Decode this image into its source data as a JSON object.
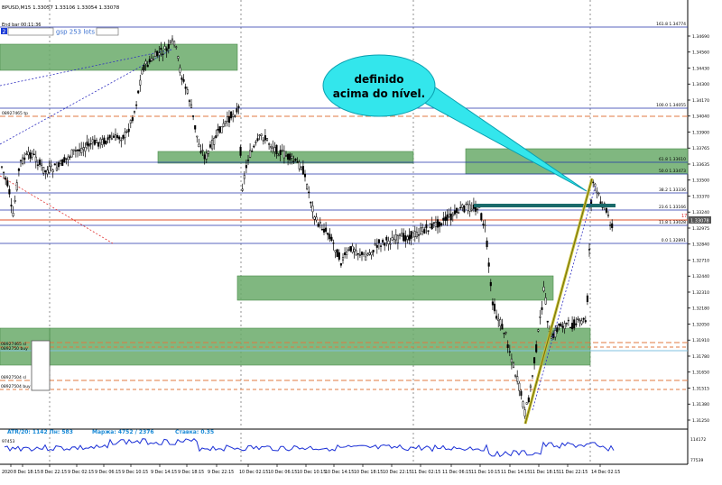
{
  "header": {
    "symbol_line": "BPUSD,M15  1.33057 1.33106 1.33054 1.33078",
    "end_bar": "End bar 00:11:36",
    "lot_badge": "2",
    "lot_text": "gsp 253 lots"
  },
  "annotation": {
    "line1": "definido",
    "line2": "acima do nível."
  },
  "colors": {
    "zone_fill": "#6aaa6a",
    "callout_fill": "#33e6ec",
    "price_line": "#e0502a",
    "fib_line": "#2233aa",
    "trend_line": "#c8c030",
    "candle": "#000000",
    "indicator_line": "#1a2fd6"
  },
  "price_axis": {
    "ticks": [
      "1.34690",
      "1.34560",
      "1.34430",
      "1.34300",
      "1.34170",
      "1.34040",
      "1.33900",
      "1.33765",
      "1.33635",
      "1.33500",
      "1.33370",
      "1.33240",
      "1.32975",
      "1.32840",
      "1.32710",
      "1.32440",
      "1.32310",
      "1.32180",
      "1.32050",
      "1.31910",
      "1.31780",
      "1.31650",
      "1.31515",
      "1.31380",
      "1.31250"
    ],
    "current_price": "1.33078"
  },
  "fib_levels": [
    {
      "label": "161.8  1.34774"
    },
    {
      "label": "100.0  1.34055"
    },
    {
      "label": "61.8  1.33610"
    },
    {
      "label": "50.0  1.33473"
    },
    {
      "label": "38.2  1.33336"
    },
    {
      "label": "23.6  1.33166"
    },
    {
      "label": "11.8  1.33028"
    },
    {
      "label": "0.0  1.32891"
    }
  ],
  "fib_marker": "17",
  "order_labels": {
    "top_left": "08927465 tp",
    "block_a": "08927465 sl",
    "block_b": "0892750 buy",
    "block_c": "08927504 sl",
    "block_d": "08927504 buy"
  },
  "stats_line": {
    "atr": "ATR/20: 1142  Пн: 583",
    "margin": "Маржа: 4752 / 2376",
    "rate": "Ставка: 0.35"
  },
  "indicator": {
    "top_left": "97453",
    "top_right": "114172",
    "bottom_right": "77539"
  },
  "time_axis": {
    "labels": [
      "2020",
      "8 Dec 18:15",
      "8 Dec 22:15",
      "9 Dec 02:15",
      "9 Dec 06:15",
      "9 Dec 10:15",
      "9 Dec 14:15",
      "9 Dec 18:15",
      "9 Dec 22:15",
      "10 Dec 02:15",
      "10 Dec 06:15",
      "10 Dec 10:15",
      "10 Dec 14:15",
      "10 Dec 18:15",
      "10 Dec 22:15",
      "11 Dec 02:15",
      "11 Dec 06:15",
      "11 Dec 10:15",
      "11 Dec 14:15",
      "11 Dec 18:15",
      "11 Dec 22:15",
      "14 Dec 02:15"
    ]
  }
}
